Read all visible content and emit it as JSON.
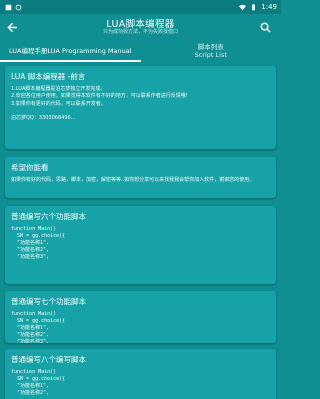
{
  "statusbar": {
    "left_icons": [
      "app-icon",
      "notification-icon"
    ],
    "right_icons": [
      "wifi-icon",
      "battery-icon"
    ],
    "time": "1:49"
  },
  "appbar": {
    "title": "LUA脚本编程器",
    "subtitle": "只为成功找方法，不为失败找借口",
    "back_icon": "arrow-left-icon",
    "search_icon": "search-icon"
  },
  "tabs": [
    {
      "label": "LUA编程手册LUA Programming Manual",
      "active": true
    },
    {
      "label": "脚本列表\nScript List",
      "active": false
    }
  ],
  "cards": [
    {
      "title": "LUA 脚本编程器 -前言",
      "body": "1.LUA脚本编程器是泊芯梦独立开发完成。\n2.欢迎各位用户使用，如果觉得本软件有不好的地方，可以联系作者进行反馈哦!\n3.如果你有更好的代码，可以联系开发者。",
      "footer": "泊芯梦QQ：3303068496..."
    },
    {
      "title": "希望你能看",
      "body": "如果你有好的代码，思路，脚本，加密，解密等等..如你想分享可以来找我我会帮你加入软件，谢谢您的使用。",
      "footer": ""
    },
    {
      "title": "普通编写六个功能脚本",
      "code": "function Main()\n  SN = gg.choice({\n  \"功能名称1\",\n  \"功能名称2\",\n  \"功能名称3\","
    },
    {
      "title": "普通编写七个功能脚本",
      "code": "function Main()\n  SN = gg.choice({\n  \"功能名称1\",\n  \"功能名称2\",\n  \"功能名称3\","
    },
    {
      "title": "普通编写八个编写脚本",
      "code": "function Main()\n  SN = gg.choice({\n  \"功能名称1\",\n  \"功能名称2\","
    }
  ]
}
